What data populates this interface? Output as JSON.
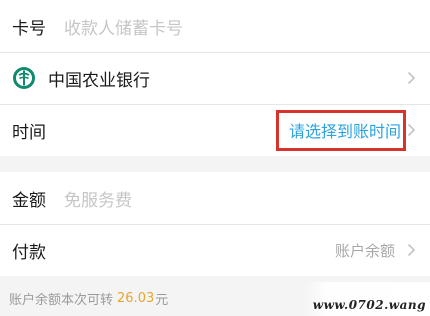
{
  "form": {
    "card_label": "卡号",
    "card_placeholder": "收款人储蓄卡号",
    "bank_name": "中国农业银行",
    "time_label": "时间",
    "time_action": "请选择到账时间",
    "amount_label": "金额",
    "amount_placeholder": "免服务费",
    "payment_label": "付款",
    "payment_value": "账户余额"
  },
  "footer": {
    "balance_text": "账户余额本次可转",
    "balance_amount": "26.03",
    "balance_unit": "元"
  },
  "watermark": {
    "text": "www.0702.wang"
  },
  "colors": {
    "accent_link": "#2aa3e0",
    "highlight_box": "#d6332d",
    "amount": "#e8a530",
    "bank_logo": "#0f8a6e"
  },
  "icons": {
    "bank": "abc-bank-logo-icon",
    "chevron": "chevron-right-icon"
  }
}
